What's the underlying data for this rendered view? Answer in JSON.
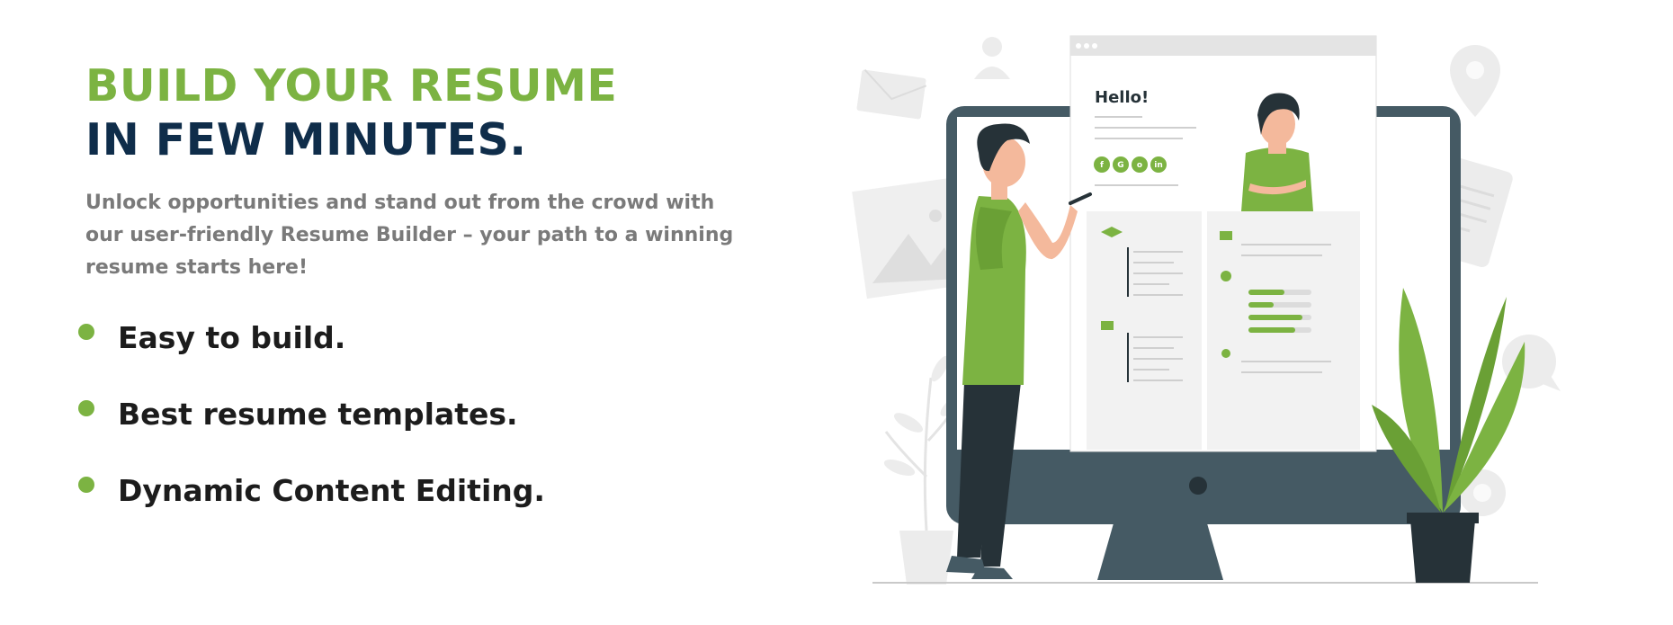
{
  "hero": {
    "title_line1": "BUILD YOUR RESUME",
    "title_line2": "IN FEW MINUTES.",
    "description": "Unlock opportunities and stand out from the crowd with our user-friendly Resume Builder – your path to a winning resume starts here!"
  },
  "features": [
    {
      "label": "Easy to build."
    },
    {
      "label": "Best resume templates."
    },
    {
      "label": "Dynamic Content Editing."
    }
  ],
  "illustration": {
    "greeting": "Hello!",
    "social_icons": [
      "facebook-icon",
      "google-plus-icon",
      "instagram-icon",
      "linkedin-icon"
    ]
  },
  "colors": {
    "accent": "#7cb342",
    "heading_dark": "#0f2d4a",
    "body_text": "#7a7a7a",
    "monitor": "#455a64"
  }
}
